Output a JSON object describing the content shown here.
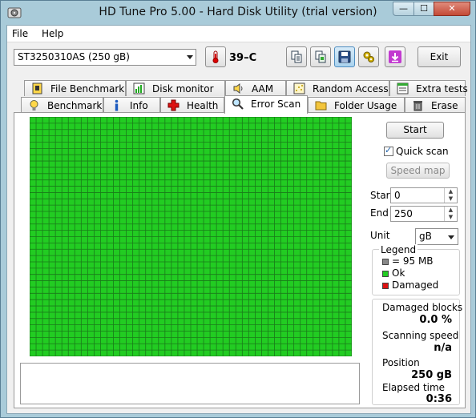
{
  "window": {
    "title": "HD Tune Pro 5.00 - Hard Disk Utility (trial version)",
    "min_glyph": "—",
    "max_glyph": "☐",
    "close_glyph": "✕"
  },
  "menu": {
    "file": "File",
    "help": "Help"
  },
  "toolbar": {
    "drive": "ST3250310AS (250 gB)",
    "temperature": "39–C",
    "exit_label": "Exit",
    "icons": [
      "copy-text-icon",
      "copy-screenshot-icon",
      "save-icon",
      "options-icon",
      "download-icon"
    ]
  },
  "tabs": {
    "row_back": [
      "File Benchmark",
      "Disk monitor",
      "AAM",
      "Random Access",
      "Extra tests"
    ],
    "row_front": [
      "Benchmark",
      "Info",
      "Health",
      "Error Scan",
      "Folder Usage",
      "Erase"
    ],
    "active": "Error Scan"
  },
  "scan": {
    "start_button": "Start",
    "quick_scan_label": "Quick scan",
    "quick_scan_checked": true,
    "speed_map_button": "Speed map",
    "start_label": "Start",
    "start_value": "0",
    "end_label": "End",
    "end_value": "250",
    "unit_label": "Unit",
    "unit_value": "gB"
  },
  "legend": {
    "title": "Legend",
    "block_size": "= 95 MB",
    "ok": "Ok",
    "damaged": "Damaged"
  },
  "stats": {
    "damaged_blocks_label": "Damaged blocks",
    "damaged_blocks_value": "0.0 %",
    "scanning_speed_label": "Scanning speed",
    "scanning_speed_value": "n/a",
    "position_label": "Position",
    "position_value": "250 gB",
    "elapsed_label": "Elapsed time",
    "elapsed_value": "0:36"
  },
  "colors": {
    "ok": "#22cc22",
    "damaged": "#dd1111",
    "grid_line": "#1a7a1a"
  }
}
